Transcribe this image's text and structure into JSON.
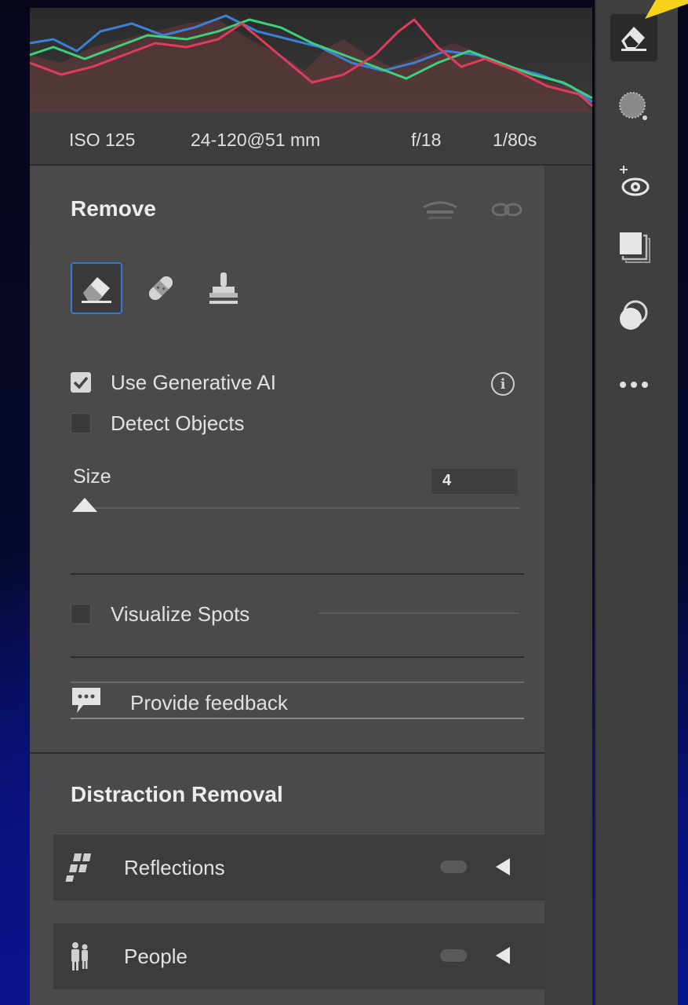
{
  "exif": {
    "iso": "ISO 125",
    "lens": "24-120@51 mm",
    "aperture": "f/18",
    "shutter": "1/80s"
  },
  "remove": {
    "title": "Remove",
    "tools": [
      "eraser-icon",
      "bandage-icon",
      "clone-stamp-icon"
    ],
    "use_generative_ai": {
      "label": "Use Generative AI",
      "checked": true
    },
    "detect_objects": {
      "label": "Detect Objects",
      "checked": false
    },
    "size": {
      "label": "Size",
      "value": "4"
    },
    "visualize_spots": {
      "label": "Visualize Spots",
      "checked": false
    },
    "feedback_label": "Provide feedback"
  },
  "distraction_removal": {
    "title": "Distraction Removal",
    "items": [
      {
        "label": "Reflections",
        "icon": "reflections-icon"
      },
      {
        "label": "People",
        "icon": "people-icon"
      }
    ]
  },
  "toolbar": {
    "items": [
      "eraser-icon",
      "masking-icon",
      "red-eye-icon",
      "presets-icon",
      "snapshots-icon",
      "more-icon"
    ]
  },
  "colors": {
    "accent": "#2f7bd8",
    "highlight_yellow": "#f6d21a"
  }
}
